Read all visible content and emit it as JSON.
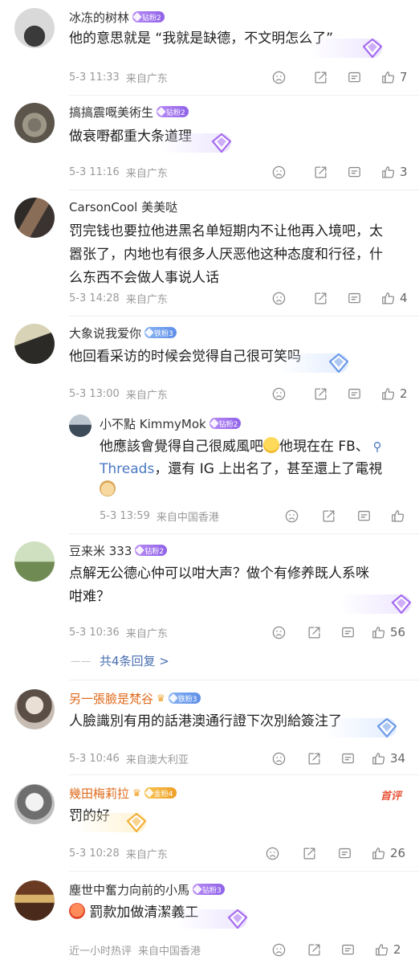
{
  "comments": [
    {
      "user": "冰冻的树林",
      "badge": "钻粉2",
      "text": "他的意思就是 “我就是缺德，不文明怎么了”",
      "date": "5-3 11:33",
      "location": "来自广东",
      "likes": "7"
    },
    {
      "user": "搞搞震嘅美術生",
      "badge": "钻粉2",
      "text": "做衰嘢都重大条道理",
      "date": "5-3 11:16",
      "location": "来自广东",
      "likes": "3"
    },
    {
      "user": "CarsonCool 美美哒",
      "text_lines": [
        "罚完钱也要拉他进黑名单短期内不让他再入境吧，太",
        "嚣张了，内地也有很多人厌恶他这种态度和行径，什",
        "么东西不会做人事说人话"
      ],
      "date": "5-3 14:28",
      "location": "来自广东",
      "likes": "4"
    },
    {
      "user": "大象说我爱你",
      "badge": "铁粉3",
      "text": "他回看采访的时候会觉得自己很可笑吗",
      "date": "5-3 13:00",
      "location": "来自广东",
      "likes": "2",
      "reply": {
        "user": "小不點 KimmyMok",
        "badge": "钻粉2",
        "line1_a": "他應該會覺得自己很威風吧",
        "line1_b": "他現在在 FB、",
        "line2_link": "Threads",
        "line2_rest": "，還有 IG 上出名了，甚至還上了電視",
        "date": "5-3 13:59",
        "location": "来自中国香港"
      }
    },
    {
      "user": "豆来米 333",
      "badge": "钻粉2",
      "text_lines": [
        "点解无公德心仲可以咁大声？做个有修养既人系咪",
        "咁难？"
      ],
      "date": "5-3 10:36",
      "location": "来自广东",
      "likes": "56",
      "more_replies": "共4条回复 >"
    },
    {
      "user": "另一張臉是梵谷",
      "badge": "铁粉3",
      "text": "人臉識別有用的話港澳通行證下次別給簽注了",
      "date": "5-3 10:46",
      "location": "来自澳大利亚",
      "likes": "34"
    },
    {
      "user": "幾田梅莉拉",
      "badge": "金粉4",
      "hot_label": "首评",
      "text": "罚的好",
      "date": "5-3 10:28",
      "location": "来自广东",
      "likes": "26"
    },
    {
      "user": "塵世中奮力向前的小馬",
      "badge": "钻粉3",
      "text": "罰款加做清潔義工",
      "date": "近一小时热评",
      "location": "来自中国香港",
      "likes": "2"
    }
  ],
  "colors": {
    "link": "#4a78c2",
    "badge_purple": "#9b6df0",
    "badge_blue": "#6b98ea",
    "badge_gold": "#f2ae34",
    "hot": "#e8563a"
  },
  "icons": [
    "dislike-icon",
    "share-icon",
    "comment-icon",
    "like-icon",
    "search-icon",
    "gem-icon",
    "crown-icon"
  ]
}
